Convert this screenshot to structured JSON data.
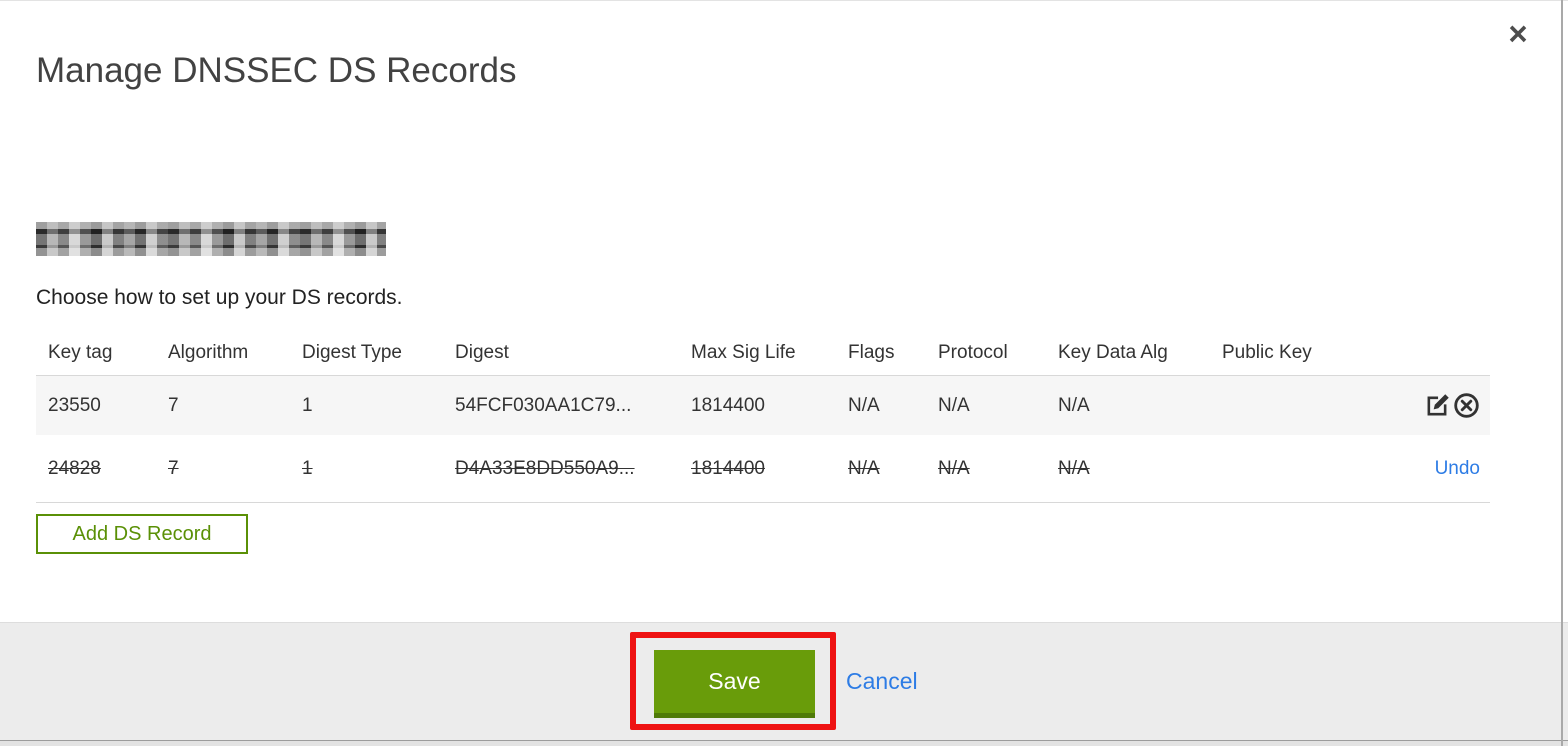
{
  "modal": {
    "title": "Manage DNSSEC DS Records",
    "close_icon": "×",
    "subtitle": "Choose how to set up your DS records.",
    "domain_name_redacted": "(pixelated/redacted domain name)",
    "table": {
      "columns": [
        "Key tag",
        "Algorithm",
        "Digest Type",
        "Digest",
        "Max Sig Life",
        "Flags",
        "Protocol",
        "Key Data Alg",
        "Public Key"
      ],
      "rows": [
        {
          "key_tag": "23550",
          "algorithm": "7",
          "digest_type": "1",
          "digest": "54FCF030AA1C79...",
          "max_sig_life": "1814400",
          "flags": "N/A",
          "protocol": "N/A",
          "key_data_alg": "N/A",
          "public_key": "",
          "state": "normal",
          "actions": [
            "edit",
            "delete"
          ]
        },
        {
          "key_tag": "24828",
          "algorithm": "7",
          "digest_type": "1",
          "digest": "D4A33E8DD550A9...",
          "max_sig_life": "1814400",
          "flags": "N/A",
          "protocol": "N/A",
          "key_data_alg": "N/A",
          "public_key": "",
          "state": "deleted-strikethrough",
          "undo_label": "Undo"
        }
      ]
    },
    "add_button_label": "Add DS Record",
    "footer": {
      "save_label": "Save",
      "cancel_label": "Cancel"
    }
  },
  "annotation": {
    "type": "red-highlight-box",
    "target": "save-button",
    "color": "#ee1212"
  },
  "colors": {
    "accent_green": "#699c0a",
    "green_border": "#5a9006",
    "link_blue": "#2d7ce5",
    "row_alt_bg": "#f6f6f6",
    "footer_bg": "#ececec",
    "annotation_red": "#ee1212"
  }
}
